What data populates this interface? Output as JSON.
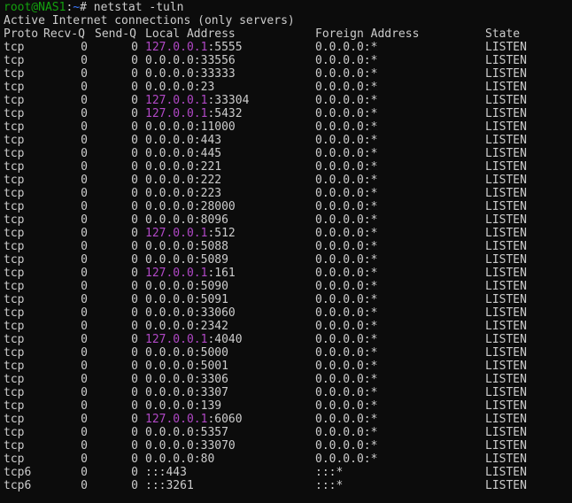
{
  "prompt": {
    "user_host": "root@NAS1",
    "separator": ":",
    "path": "~",
    "symbol": "# ",
    "command": "netstat -tuln"
  },
  "heading": "Active Internet connections (only servers)",
  "columns": {
    "proto": "Proto",
    "recvq": "Recv-Q",
    "sendq": "Send-Q",
    "local": "Local Address",
    "foreign": "Foreign Address",
    "state": "State"
  },
  "colors": {
    "background": "#0c0c0c",
    "foreground": "#cccccc",
    "prompt_user": "#13a10e",
    "prompt_path": "#3b78ff",
    "loopback_ip": "#b148c6"
  },
  "rows": [
    {
      "proto": "tcp",
      "recvq": "0",
      "sendq": "0",
      "ip": "127.0.0.1",
      "port": ":5555",
      "foreign": "0.0.0.0:*",
      "state": "LISTEN"
    },
    {
      "proto": "tcp",
      "recvq": "0",
      "sendq": "0",
      "ip": "0.0.0.0",
      "port": ":33556",
      "foreign": "0.0.0.0:*",
      "state": "LISTEN"
    },
    {
      "proto": "tcp",
      "recvq": "0",
      "sendq": "0",
      "ip": "0.0.0.0",
      "port": ":33333",
      "foreign": "0.0.0.0:*",
      "state": "LISTEN"
    },
    {
      "proto": "tcp",
      "recvq": "0",
      "sendq": "0",
      "ip": "0.0.0.0",
      "port": ":23",
      "foreign": "0.0.0.0:*",
      "state": "LISTEN"
    },
    {
      "proto": "tcp",
      "recvq": "0",
      "sendq": "0",
      "ip": "127.0.0.1",
      "port": ":33304",
      "foreign": "0.0.0.0:*",
      "state": "LISTEN"
    },
    {
      "proto": "tcp",
      "recvq": "0",
      "sendq": "0",
      "ip": "127.0.0.1",
      "port": ":5432",
      "foreign": "0.0.0.0:*",
      "state": "LISTEN"
    },
    {
      "proto": "tcp",
      "recvq": "0",
      "sendq": "0",
      "ip": "0.0.0.0",
      "port": ":11000",
      "foreign": "0.0.0.0:*",
      "state": "LISTEN"
    },
    {
      "proto": "tcp",
      "recvq": "0",
      "sendq": "0",
      "ip": "0.0.0.0",
      "port": ":443",
      "foreign": "0.0.0.0:*",
      "state": "LISTEN"
    },
    {
      "proto": "tcp",
      "recvq": "0",
      "sendq": "0",
      "ip": "0.0.0.0",
      "port": ":445",
      "foreign": "0.0.0.0:*",
      "state": "LISTEN"
    },
    {
      "proto": "tcp",
      "recvq": "0",
      "sendq": "0",
      "ip": "0.0.0.0",
      "port": ":221",
      "foreign": "0.0.0.0:*",
      "state": "LISTEN"
    },
    {
      "proto": "tcp",
      "recvq": "0",
      "sendq": "0",
      "ip": "0.0.0.0",
      "port": ":222",
      "foreign": "0.0.0.0:*",
      "state": "LISTEN"
    },
    {
      "proto": "tcp",
      "recvq": "0",
      "sendq": "0",
      "ip": "0.0.0.0",
      "port": ":223",
      "foreign": "0.0.0.0:*",
      "state": "LISTEN"
    },
    {
      "proto": "tcp",
      "recvq": "0",
      "sendq": "0",
      "ip": "0.0.0.0",
      "port": ":28000",
      "foreign": "0.0.0.0:*",
      "state": "LISTEN"
    },
    {
      "proto": "tcp",
      "recvq": "0",
      "sendq": "0",
      "ip": "0.0.0.0",
      "port": ":8096",
      "foreign": "0.0.0.0:*",
      "state": "LISTEN"
    },
    {
      "proto": "tcp",
      "recvq": "0",
      "sendq": "0",
      "ip": "127.0.0.1",
      "port": ":512",
      "foreign": "0.0.0.0:*",
      "state": "LISTEN"
    },
    {
      "proto": "tcp",
      "recvq": "0",
      "sendq": "0",
      "ip": "0.0.0.0",
      "port": ":5088",
      "foreign": "0.0.0.0:*",
      "state": "LISTEN"
    },
    {
      "proto": "tcp",
      "recvq": "0",
      "sendq": "0",
      "ip": "0.0.0.0",
      "port": ":5089",
      "foreign": "0.0.0.0:*",
      "state": "LISTEN"
    },
    {
      "proto": "tcp",
      "recvq": "0",
      "sendq": "0",
      "ip": "127.0.0.1",
      "port": ":161",
      "foreign": "0.0.0.0:*",
      "state": "LISTEN"
    },
    {
      "proto": "tcp",
      "recvq": "0",
      "sendq": "0",
      "ip": "0.0.0.0",
      "port": ":5090",
      "foreign": "0.0.0.0:*",
      "state": "LISTEN"
    },
    {
      "proto": "tcp",
      "recvq": "0",
      "sendq": "0",
      "ip": "0.0.0.0",
      "port": ":5091",
      "foreign": "0.0.0.0:*",
      "state": "LISTEN"
    },
    {
      "proto": "tcp",
      "recvq": "0",
      "sendq": "0",
      "ip": "0.0.0.0",
      "port": ":33060",
      "foreign": "0.0.0.0:*",
      "state": "LISTEN"
    },
    {
      "proto": "tcp",
      "recvq": "0",
      "sendq": "0",
      "ip": "0.0.0.0",
      "port": ":2342",
      "foreign": "0.0.0.0:*",
      "state": "LISTEN"
    },
    {
      "proto": "tcp",
      "recvq": "0",
      "sendq": "0",
      "ip": "127.0.0.1",
      "port": ":4040",
      "foreign": "0.0.0.0:*",
      "state": "LISTEN"
    },
    {
      "proto": "tcp",
      "recvq": "0",
      "sendq": "0",
      "ip": "0.0.0.0",
      "port": ":5000",
      "foreign": "0.0.0.0:*",
      "state": "LISTEN"
    },
    {
      "proto": "tcp",
      "recvq": "0",
      "sendq": "0",
      "ip": "0.0.0.0",
      "port": ":5001",
      "foreign": "0.0.0.0:*",
      "state": "LISTEN"
    },
    {
      "proto": "tcp",
      "recvq": "0",
      "sendq": "0",
      "ip": "0.0.0.0",
      "port": ":3306",
      "foreign": "0.0.0.0:*",
      "state": "LISTEN"
    },
    {
      "proto": "tcp",
      "recvq": "0",
      "sendq": "0",
      "ip": "0.0.0.0",
      "port": ":3307",
      "foreign": "0.0.0.0:*",
      "state": "LISTEN"
    },
    {
      "proto": "tcp",
      "recvq": "0",
      "sendq": "0",
      "ip": "0.0.0.0",
      "port": ":139",
      "foreign": "0.0.0.0:*",
      "state": "LISTEN"
    },
    {
      "proto": "tcp",
      "recvq": "0",
      "sendq": "0",
      "ip": "127.0.0.1",
      "port": ":6060",
      "foreign": "0.0.0.0:*",
      "state": "LISTEN"
    },
    {
      "proto": "tcp",
      "recvq": "0",
      "sendq": "0",
      "ip": "0.0.0.0",
      "port": ":5357",
      "foreign": "0.0.0.0:*",
      "state": "LISTEN"
    },
    {
      "proto": "tcp",
      "recvq": "0",
      "sendq": "0",
      "ip": "0.0.0.0",
      "port": ":33070",
      "foreign": "0.0.0.0:*",
      "state": "LISTEN"
    },
    {
      "proto": "tcp",
      "recvq": "0",
      "sendq": "0",
      "ip": "0.0.0.0",
      "port": ":80",
      "foreign": "0.0.0.0:*",
      "state": "LISTEN"
    },
    {
      "proto": "tcp6",
      "recvq": "0",
      "sendq": "0",
      "ip": ":::",
      "port": "443",
      "foreign": ":::*",
      "state": "LISTEN"
    },
    {
      "proto": "tcp6",
      "recvq": "0",
      "sendq": "0",
      "ip": ":::",
      "port": "3261",
      "foreign": ":::*",
      "state": "LISTEN"
    }
  ]
}
